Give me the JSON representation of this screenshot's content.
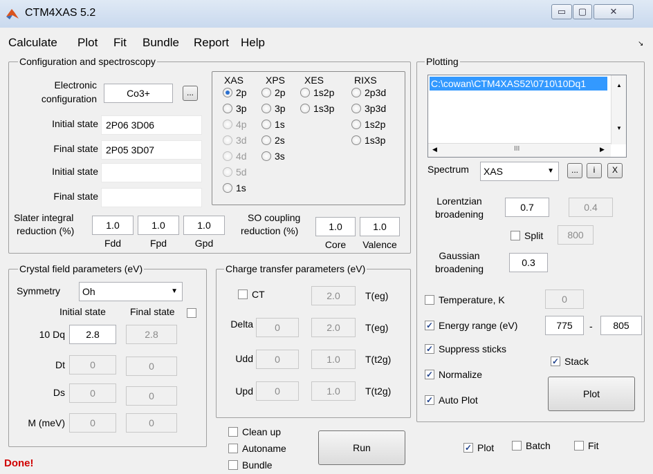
{
  "window": {
    "title": "CTM4XAS 5.2",
    "minimize": "▭",
    "maximize": "▢",
    "close": "✕"
  },
  "menu": [
    "Calculate",
    "Plot",
    "Fit",
    "Bundle",
    "Report",
    "Help"
  ],
  "toolbar_arrow": "↘",
  "config": {
    "title": "Configuration and spectroscopy",
    "electronic_label_1": "Electronic",
    "electronic_label_2": "configuration",
    "electronic_value": "Co3+",
    "browse_label": "...",
    "initial_state_label": "Initial state",
    "initial_state_value": "2P06 3D06",
    "final_state_label": "Final state",
    "final_state_value": "2P05 3D07",
    "initial_state2_label": "Initial state",
    "initial_state2_value": "",
    "final_state2_label": "Final state",
    "final_state2_value": "",
    "slater_label_1": "Slater integral",
    "slater_label_2": "reduction (%)",
    "fdd": {
      "value": "1.0",
      "label": "Fdd"
    },
    "fpd": {
      "value": "1.0",
      "label": "Fpd"
    },
    "gpd": {
      "value": "1.0",
      "label": "Gpd"
    },
    "so_label_1": "SO coupling",
    "so_label_2": "reduction (%)",
    "core": {
      "value": "1.0",
      "label": "Core"
    },
    "valence": {
      "value": "1.0",
      "label": "Valence"
    }
  },
  "spectroscopy": {
    "headers": {
      "xas": "XAS",
      "xps": "XPS",
      "xes": "XES",
      "rixs": "RIXS"
    },
    "xas": [
      {
        "label": "2p",
        "selected": true,
        "enabled": true
      },
      {
        "label": "3p",
        "selected": false,
        "enabled": true
      },
      {
        "label": "4p",
        "selected": false,
        "enabled": false
      },
      {
        "label": "3d",
        "selected": false,
        "enabled": false
      },
      {
        "label": "4d",
        "selected": false,
        "enabled": false
      },
      {
        "label": "5d",
        "selected": false,
        "enabled": false
      },
      {
        "label": "1s",
        "selected": false,
        "enabled": true
      }
    ],
    "xps": [
      "2p",
      "3p",
      "1s",
      "2s",
      "3s"
    ],
    "xes": [
      "1s2p",
      "1s3p"
    ],
    "rixs": [
      "2p3d",
      "3p3d",
      "1s2p",
      "1s3p"
    ]
  },
  "crystal": {
    "title": "Crystal field parameters (eV)",
    "symmetry_label": "Symmetry",
    "symmetry_value": "Oh",
    "initial_header": "Initial state",
    "final_header": "Final state",
    "rows": [
      {
        "label": "10 Dq",
        "initial": "2.8",
        "final": "2.8"
      },
      {
        "label": "Dt",
        "initial": "0",
        "final": "0"
      },
      {
        "label": "Ds",
        "initial": "0",
        "final": "0"
      },
      {
        "label": "M (meV)",
        "initial": "0",
        "final": "0"
      }
    ]
  },
  "charge": {
    "title": "Charge transfer parameters (eV)",
    "ct_label": "CT",
    "ct_value": "2.0",
    "ct_unit": "T(eg)",
    "rows": [
      {
        "label": "Delta",
        "v1": "0",
        "v2": "2.0",
        "unit": "T(eg)"
      },
      {
        "label": "Udd",
        "v1": "0",
        "v2": "1.0",
        "unit": "T(t2g)"
      },
      {
        "label": "Upd",
        "v1": "0",
        "v2": "1.0",
        "unit": "T(t2g)"
      }
    ]
  },
  "plotting": {
    "title": "Plotting",
    "file": "C:\\cowan\\CTM4XAS52\\0710\\10Dq1",
    "scroll_dots": "III",
    "spectrum_label": "Spectrum",
    "spectrum_value": "XAS",
    "btn_dots": "...",
    "btn_i": "i",
    "btn_x": "X",
    "lorentzian_label_1": "Lorentzian",
    "lorentzian_label_2": "broadening",
    "lorentzian_value": "0.7",
    "lorentzian_value2": "0.4",
    "split_label": "Split",
    "split_value": "800",
    "gaussian_label_1": "Gaussian",
    "gaussian_label_2": "broadening",
    "gaussian_value": "0.3",
    "temperature_label": "Temperature, K",
    "temperature_value": "0",
    "energy_label": "Energy range (eV)",
    "energy_from": "775",
    "energy_dash": "-",
    "energy_to": "805",
    "suppress_label": "Suppress sticks",
    "stack_label": "Stack",
    "normalize_label": "Normalize",
    "autoplot_label": "Auto Plot",
    "plot_button": "Plot"
  },
  "bottom": {
    "cleanup": "Clean up",
    "autoname": "Autoname",
    "bundle": "Bundle",
    "run_button": "Run",
    "plot_check": "Plot",
    "batch_check": "Batch",
    "fit_check": "Fit",
    "status": "Done!"
  }
}
